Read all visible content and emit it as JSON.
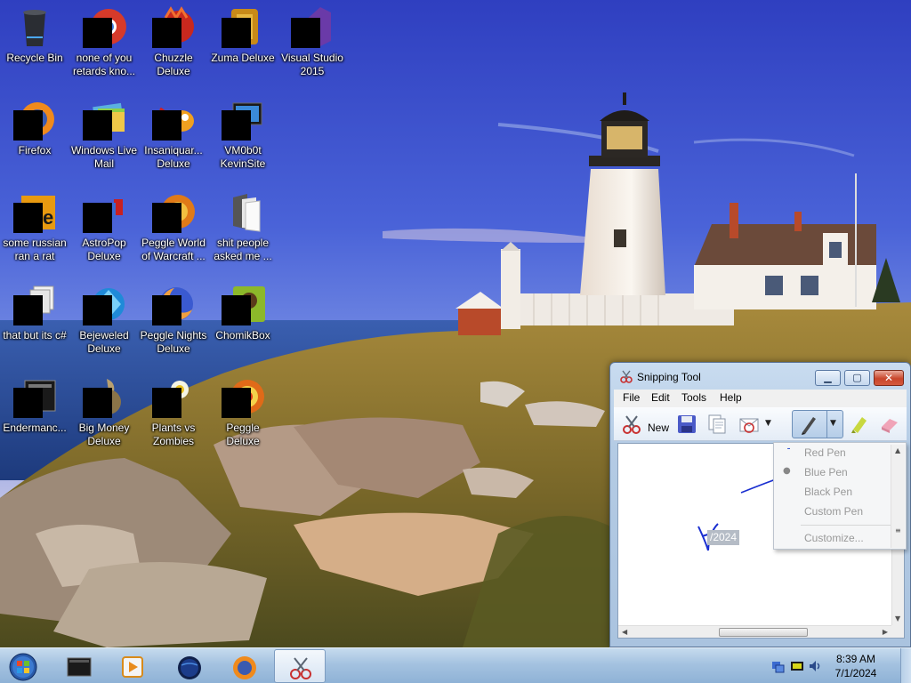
{
  "desktop": {
    "icons": [
      {
        "label": "Recycle Bin",
        "icon": "recycle-bin-icon"
      },
      {
        "label": "none of you retards kno...",
        "icon": "chrome-icon"
      },
      {
        "label": "Chuzzle Deluxe",
        "icon": "chuzzle-icon"
      },
      {
        "label": "Zuma Deluxe",
        "icon": "zuma-icon"
      },
      {
        "label": "Visual Studio 2015",
        "icon": "visual-studio-icon"
      },
      {
        "label": "Firefox",
        "icon": "firefox-icon"
      },
      {
        "label": "Windows Live Mail",
        "icon": "windows-live-mail-icon"
      },
      {
        "label": "Insaniquar... Deluxe",
        "icon": "insaniquarium-icon"
      },
      {
        "label": "VM0b0t KevinSite",
        "icon": "monitor-icon"
      },
      {
        "label": "some russian ran a rat",
        "icon": "dreamweaver-icon"
      },
      {
        "label": "AstroPop Deluxe",
        "icon": "astropop-icon"
      },
      {
        "label": "Peggle World of Warcraft ...",
        "icon": "peggle-wow-icon"
      },
      {
        "label": "shit people asked me ...",
        "icon": "folder-icon"
      },
      {
        "label": "that but its c#",
        "icon": "file-stack-icon"
      },
      {
        "label": "Bejeweled Deluxe",
        "icon": "bejeweled-icon"
      },
      {
        "label": "Peggle Nights Deluxe",
        "icon": "peggle-nights-icon"
      },
      {
        "label": "ChomikBox",
        "icon": "chomikbox-icon"
      },
      {
        "label": "Endermanc...",
        "icon": "terminal-icon"
      },
      {
        "label": "Big Money Deluxe",
        "icon": "big-money-icon"
      },
      {
        "label": "Plants vs Zombies",
        "icon": "plants-vs-zombies-icon"
      },
      {
        "label": "Peggle Deluxe",
        "icon": "peggle-icon"
      }
    ]
  },
  "snipping_tool": {
    "title": "Snipping Tool",
    "menu": [
      "File",
      "Edit",
      "Tools",
      "Help"
    ],
    "toolbar": {
      "new_label": "New"
    },
    "pen_menu": {
      "items": [
        "Red Pen",
        "Blue Pen",
        "Black Pen",
        "Custom Pen",
        "Customize..."
      ],
      "selected": "Blue Pen"
    },
    "canvas_text": "/2024",
    "ink_color": "#1a2fd0"
  },
  "taskbar": {
    "items": [
      "start-orb-icon",
      "terminal-icon",
      "media-player-icon",
      "globe-icon",
      "firefox-icon",
      "snipping-tool-icon"
    ],
    "clock_time": "8:39 AM",
    "clock_date": "7/1/2024"
  }
}
